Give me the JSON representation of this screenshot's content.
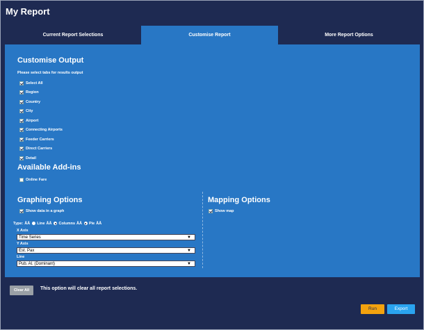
{
  "window": {
    "title": "My Report"
  },
  "tabs": [
    {
      "label": "Current Report Selections",
      "active": false
    },
    {
      "label": "Customise Report",
      "active": true
    },
    {
      "label": "More Report Options",
      "active": false
    }
  ],
  "customise_output": {
    "heading": "Customise Output",
    "instruction": "Please select tabs for results output",
    "items": [
      {
        "label": "Select All",
        "checked": true
      },
      {
        "label": "Region",
        "checked": true
      },
      {
        "label": "Country",
        "checked": true
      },
      {
        "label": "City",
        "checked": true
      },
      {
        "label": "Airport",
        "checked": true
      },
      {
        "label": "Connecting Airports",
        "checked": true
      },
      {
        "label": "Feeder Carriers",
        "checked": true
      },
      {
        "label": "Direct Carriers",
        "checked": true
      },
      {
        "label": "Detail",
        "checked": true
      }
    ]
  },
  "addins": {
    "heading": "Available Add-ins",
    "items": [
      {
        "label": "Online Fare",
        "checked": false
      }
    ]
  },
  "graphing": {
    "heading": "Graphing Options",
    "show_graph_label": "Show data in a graph",
    "show_graph_checked": true,
    "type_label": "Type:",
    "glyph": "ÂÂ",
    "types": [
      {
        "label": "Line",
        "selected": false
      },
      {
        "label": "Columns",
        "selected": true
      },
      {
        "label": "Pie",
        "selected": true
      }
    ],
    "x_axis_label": "X Axis",
    "x_axis_value": "Time Series",
    "y_axis_label": "Y Axis",
    "y_axis_value": "Est. Pax",
    "line_label": "Line",
    "line_value": "Pub. Al. (Dominant)",
    "arrow": "▼"
  },
  "mapping": {
    "heading": "Mapping Options",
    "show_map_label": "Show map",
    "show_map_checked": true
  },
  "footer": {
    "clear_button": "Clear All",
    "clear_text": "This option will clear all report selections.",
    "run_button": "Run",
    "export_button": "Export"
  }
}
